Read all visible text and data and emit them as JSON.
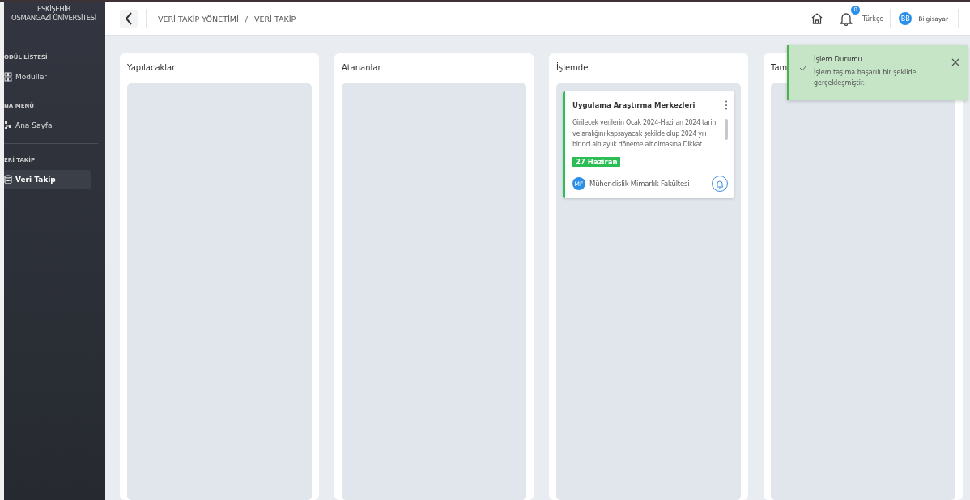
{
  "sidebar": {
    "logo_lines": [
      "ESKİŞEHİR",
      "OSMANGAZİ ÜNİVERSİTESİ"
    ],
    "sections": [
      {
        "heading": "ODÜL LİSTESİ",
        "items": [
          {
            "label": "Modüller",
            "selected": false
          }
        ]
      },
      {
        "heading": "NA MENÜ",
        "items": [
          {
            "label": "Ana Sayfa",
            "selected": false
          }
        ]
      },
      {
        "heading": "ERİ TAKİP",
        "items": [
          {
            "label": "Veri Takip",
            "selected": true
          }
        ]
      }
    ]
  },
  "header": {
    "breadcrumb": [
      "VERİ TAKİP YÖNETİMİ",
      "/",
      "VERİ TAKİP"
    ],
    "notification_count": "0",
    "language": "Türkçe",
    "user_initials": "BB",
    "user_name": "Bilgisayar"
  },
  "board": {
    "columns": [
      {
        "title": "Yapılacaklar"
      },
      {
        "title": "Atananlar"
      },
      {
        "title": "İşlemde",
        "cards": [
          {
            "title": "Uygulama Araştırma Merkezleri",
            "description": "Girilecek verilerin Ocak 2024-Haziran 2024 tarih ve aralığını kapsayacak şekilde olup 2024 yılı birinci altı aylık döneme ait olmasına Dikkat",
            "date": "27 Haziran",
            "assignee_initials": "MF",
            "assignee": "Mühendislik Mimarlık Fakültesi",
            "color": "#2dbd55"
          }
        ]
      },
      {
        "title": "Tam"
      }
    ]
  },
  "toast": {
    "title": "İşlem Durumu",
    "message": "İşlem taşıma başarılı bir şekilde gerçekleşmiştir."
  }
}
